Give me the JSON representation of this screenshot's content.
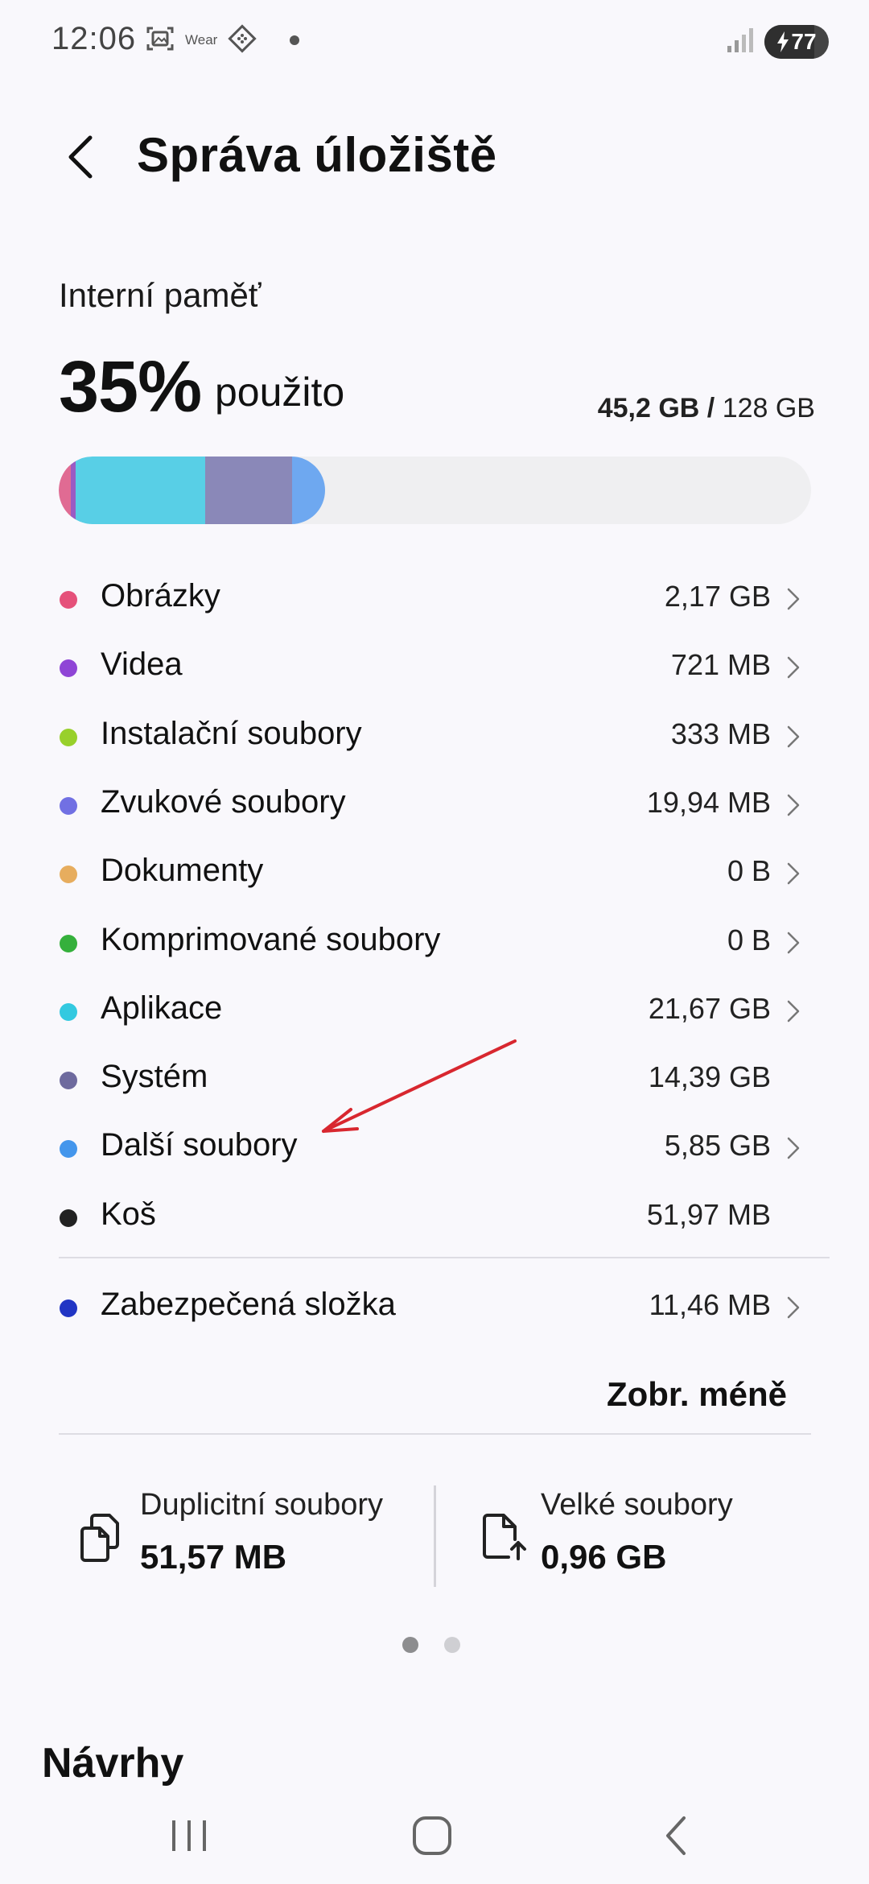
{
  "status_bar": {
    "time": "12:06",
    "wear_label": "Wear",
    "battery": "77",
    "icons": [
      "screenshot-icon",
      "wear-icon",
      "diamond-app-icon",
      "notification-dot",
      "signal-icon",
      "battery-charging-icon"
    ]
  },
  "header": {
    "title": "Správa úložiště",
    "back_icon": "back-arrow-icon"
  },
  "storage": {
    "label": "Interní paměť",
    "percent": "35%",
    "used_label": "použito",
    "used": "45,2 GB",
    "separator": "/",
    "total": "128 GB",
    "fill_percent": 35,
    "segments": [
      {
        "color": "#e06b93",
        "share": 0.016
      },
      {
        "color": "#9a5bc4",
        "share": 0.006
      },
      {
        "color": "#58cfe6",
        "share": 0.173
      },
      {
        "color": "#8a88b8",
        "share": 0.115
      },
      {
        "color": "#6ea8f0",
        "share": 0.044
      }
    ]
  },
  "categories": [
    {
      "name": "Obrázky",
      "size": "2,17 GB",
      "color": "#e5517a",
      "chevron": true
    },
    {
      "name": "Videa",
      "size": "721 MB",
      "color": "#8f45d6",
      "chevron": true
    },
    {
      "name": "Instalační soubory",
      "size": "333 MB",
      "color": "#98d02b",
      "chevron": true
    },
    {
      "name": "Zvukové soubory",
      "size": "19,94 MB",
      "color": "#7170e3",
      "chevron": true
    },
    {
      "name": "Dokumenty",
      "size": "0 B",
      "color": "#e7ad5e",
      "chevron": true
    },
    {
      "name": "Komprimované soubory",
      "size": "0 B",
      "color": "#35b03c",
      "chevron": true
    },
    {
      "name": "Aplikace",
      "size": "21,67 GB",
      "color": "#33c9e0",
      "chevron": true
    },
    {
      "name": "Systém",
      "size": "14,39 GB",
      "color": "#6e6a9e",
      "chevron": false
    },
    {
      "name": "Další soubory",
      "size": "5,85 GB",
      "color": "#4496ec",
      "chevron": true
    },
    {
      "name": "Koš",
      "size": "51,97 MB",
      "color": "#222222",
      "chevron": false
    }
  ],
  "secure_folder": {
    "name": "Zabezpečená složka",
    "size": "11,46 MB",
    "color": "#2135c4",
    "chevron": true
  },
  "show_less": "Zobr. méně",
  "cards": [
    {
      "title": "Duplicitní soubory",
      "value": "51,57 MB",
      "icon": "duplicate-files-icon"
    },
    {
      "title": "Velké soubory",
      "value": "0,96 GB",
      "icon": "large-file-icon"
    }
  ],
  "pager": {
    "count": 2,
    "active": 0
  },
  "suggestions_title": "Návrhy",
  "annotation": {
    "type": "arrow",
    "color": "#d8272f"
  },
  "nav": {
    "icons": [
      "recents-icon",
      "home-icon",
      "back-icon"
    ]
  }
}
